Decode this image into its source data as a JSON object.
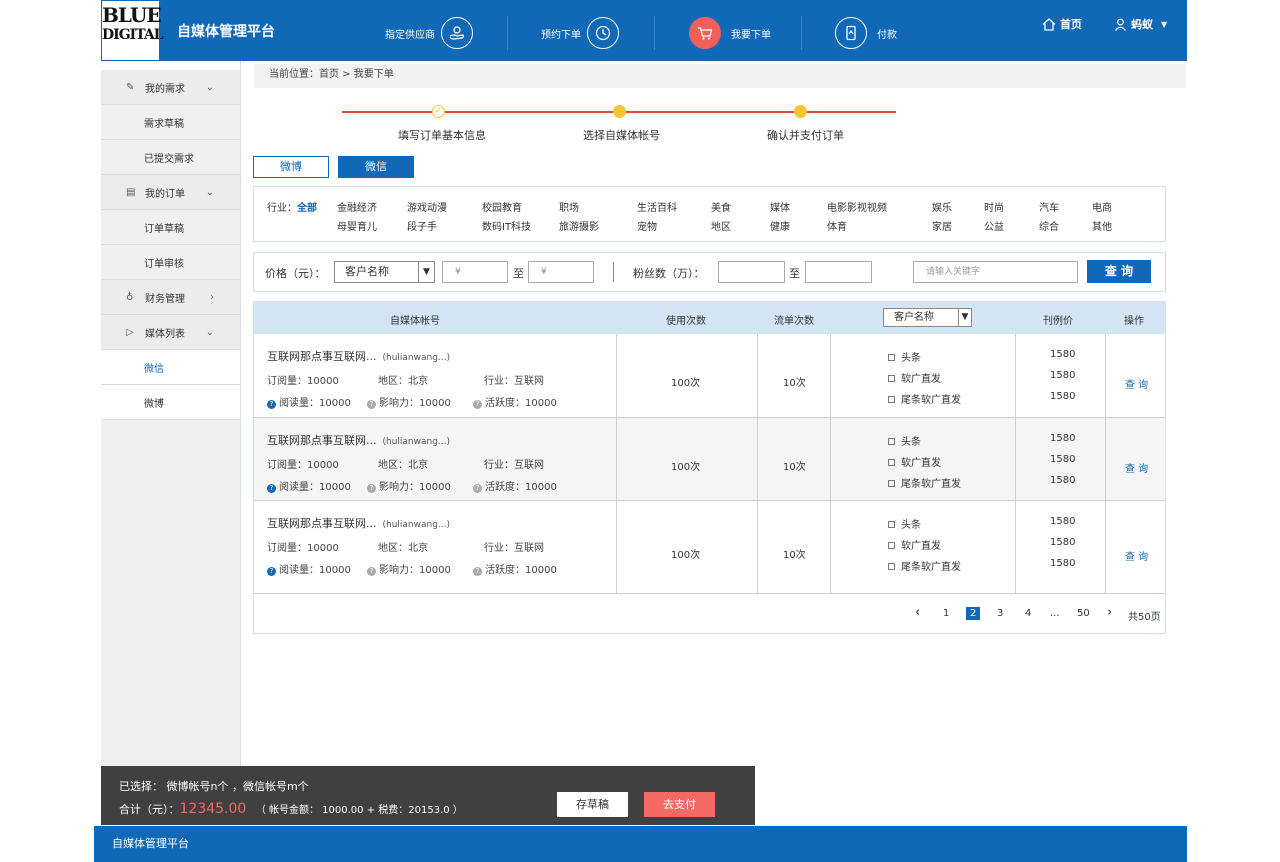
{
  "header": {
    "logo_line1": "BLUE",
    "logo_line2": "DIGITAL",
    "app_title": "自媒体管理平台",
    "nav": [
      {
        "label": "指定供应商",
        "icon": "supplier-hand-icon"
      },
      {
        "label": "预约下单",
        "icon": "clock-icon"
      },
      {
        "label": "我要下单",
        "icon": "cart-icon",
        "active": true
      },
      {
        "label": "付款",
        "icon": "payment-phone-icon"
      }
    ],
    "home_label": "首页",
    "user_name": "蚂蚁",
    "accent_color": "#1168b7",
    "highlight_color": "#f0605a"
  },
  "sidebar": {
    "groups": [
      {
        "label": "我的需求",
        "icon": "edit-icon",
        "items": [
          "需求草稿",
          "已提交需求"
        ]
      },
      {
        "label": "我的订单",
        "icon": "clipboard-icon",
        "items": [
          "订单草稿",
          "订单审核"
        ]
      },
      {
        "label": "财务管理",
        "icon": "money-bag-icon",
        "items": []
      },
      {
        "label": "媒体列表",
        "icon": "play-icon",
        "items": [
          "微信",
          "微博"
        ]
      }
    ]
  },
  "breadcrumb": "当前位置：首页 > 我要下单",
  "steps": [
    "填写订单基本信息",
    "选择自媒体帐号",
    "确认并支付订单"
  ],
  "tabs": [
    "微博",
    "微信"
  ],
  "filter": {
    "label": "行业：",
    "all": "全部",
    "row1": [
      "金融经济",
      "游戏动漫",
      "校园教育",
      "职场",
      "生活百科",
      "美食",
      "媒体",
      "电影影视视频",
      "娱乐",
      "时尚",
      "汽车",
      "电商"
    ],
    "row2": [
      "母婴育儿",
      "段子手",
      "数码IT科技",
      "旅游摄影",
      "宠物",
      "地区",
      "健康",
      "体育",
      "家居",
      "公益",
      "综合",
      "其他"
    ]
  },
  "price": {
    "label": "价格（元）：",
    "select_value": "客户名称",
    "min_placeholder": "¥",
    "max_placeholder": "¥",
    "to": "至",
    "fans_label": "粉丝数（万）：",
    "fans_to": "至",
    "search_placeholder": "请输入关键字",
    "search_button": "查 询"
  },
  "table": {
    "headers": {
      "account": "自媒体帐号",
      "uses": "使用次数",
      "orders": "流单次数",
      "position_select": "客户名称",
      "price": "刊例价",
      "action": "操作"
    },
    "rows": [
      {
        "name": "互联网那点事互联网...",
        "handle": "(hulianwang...)",
        "subs": "订阅量：10000",
        "region": "地区：北京",
        "industry": "行业：互联网",
        "reads": "阅读量：10000",
        "influence": "影响力：10000",
        "activity": "活跃度：10000",
        "uses": "100次",
        "orders": "10次",
        "positions": [
          "头条",
          "软广直发",
          "尾条软广直发"
        ],
        "prices": [
          "1580",
          "1580",
          "1580"
        ],
        "action": "查 询"
      },
      {
        "name": "互联网那点事互联网...",
        "handle": "(hulianwang...)",
        "subs": "订阅量：10000",
        "region": "地区：北京",
        "industry": "行业：互联网",
        "reads": "阅读量：10000",
        "influence": "影响力：10000",
        "activity": "活跃度：10000",
        "uses": "100次",
        "orders": "10次",
        "positions": [
          "头条",
          "软广直发",
          "尾条软广直发"
        ],
        "prices": [
          "1580",
          "1580",
          "1580"
        ],
        "action": "查 询"
      },
      {
        "name": "互联网那点事互联网...",
        "handle": "(hulianwang...)",
        "subs": "订阅量：10000",
        "region": "地区：北京",
        "industry": "行业：互联网",
        "reads": "阅读量：10000",
        "influence": "影响力：10000",
        "activity": "活跃度：10000",
        "uses": "100次",
        "orders": "10次",
        "positions": [
          "头条",
          "软广直发",
          "尾条软广直发"
        ],
        "prices": [
          "1580",
          "1580",
          "1580"
        ],
        "action": "查 询"
      }
    ]
  },
  "pagination": {
    "prev": "‹",
    "next": "›",
    "pages": [
      "1",
      "2",
      "3",
      "4",
      "...",
      "50"
    ],
    "current": "2",
    "total": "共50页"
  },
  "summary": {
    "selected": "已选择：  微博帐号n个 ，微信帐号m个",
    "total_label": "合计（元）：",
    "total_value": "12345.00",
    "breakdown": "（ 帐号金额： 1000.00  +  税费：20153.0 ）",
    "draft_button": "存草稿",
    "pay_button": "去支付"
  },
  "footer": "自媒体管理平台"
}
